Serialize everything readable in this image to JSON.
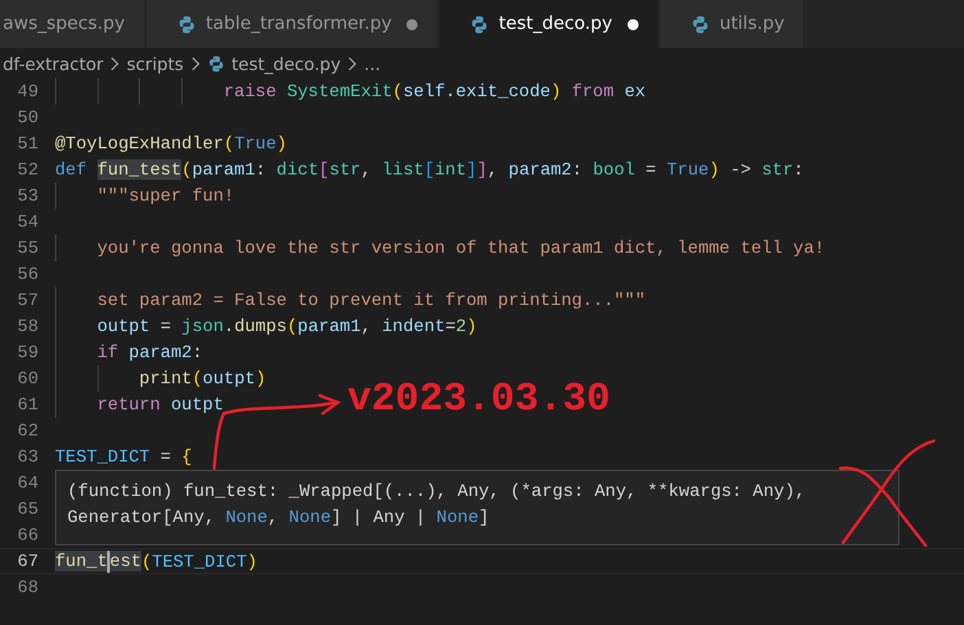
{
  "tabs": [
    {
      "label": "aws_specs.py",
      "selected": false,
      "modified": false,
      "icon": false
    },
    {
      "label": "table_transformer.py",
      "selected": false,
      "modified": true,
      "icon": true
    },
    {
      "label": "test_deco.py",
      "selected": true,
      "modified": true,
      "icon": true
    },
    {
      "label": "utils.py",
      "selected": false,
      "modified": false,
      "icon": true
    }
  ],
  "breadcrumb": [
    {
      "label": "df-extractor",
      "icon": false
    },
    {
      "label": "scripts",
      "icon": false
    },
    {
      "label": "test_deco.py",
      "icon": true
    },
    {
      "label": "...",
      "icon": false
    }
  ],
  "lines": [
    {
      "number": "49",
      "tokens": [
        {
          "t": "                raise ",
          "kind": "kw"
        },
        {
          "t": "SystemExit",
          "kind": "cls"
        },
        {
          "t": "(",
          "kind": "b1"
        },
        {
          "t": "self",
          "kind": "var"
        },
        {
          "t": ".exit_code",
          "kind": "var"
        },
        {
          "t": ") ",
          "kind": "b1"
        },
        {
          "t": "from ",
          "kind": "kw"
        },
        {
          "t": "ex",
          "kind": "var"
        }
      ]
    },
    {
      "number": "50"
    },
    {
      "number": "51",
      "tokens": [
        {
          "t": "@ToyLogExHandler",
          "kind": "fn"
        },
        {
          "t": "(",
          "kind": "b1"
        },
        {
          "t": "True",
          "kind": "def"
        },
        {
          "t": ")",
          "kind": "b1"
        }
      ]
    },
    {
      "number": "52",
      "tokens": [
        {
          "t": "def ",
          "kind": "def"
        },
        {
          "t": "fun_test",
          "kind": "fn",
          "highlight": true
        },
        {
          "t": "(",
          "kind": "b1"
        },
        {
          "t": "param1",
          "kind": "var"
        },
        {
          "t": ": ",
          "kind": "plain"
        },
        {
          "t": "dict",
          "kind": "cls"
        },
        {
          "t": "[",
          "kind": "b2"
        },
        {
          "t": "str",
          "kind": "cls"
        },
        {
          "t": ", ",
          "kind": "plain"
        },
        {
          "t": "list",
          "kind": "cls"
        },
        {
          "t": "[",
          "kind": "b3"
        },
        {
          "t": "int",
          "kind": "cls"
        },
        {
          "t": "]",
          "kind": "b3"
        },
        {
          "t": "]",
          "kind": "b2"
        },
        {
          "t": ", ",
          "kind": "plain"
        },
        {
          "t": "param2",
          "kind": "var"
        },
        {
          "t": ": ",
          "kind": "plain"
        },
        {
          "t": "bool",
          "kind": "cls"
        },
        {
          "t": " = ",
          "kind": "plain"
        },
        {
          "t": "True",
          "kind": "def"
        },
        {
          "t": ")",
          "kind": "b1"
        },
        {
          "t": " -> ",
          "kind": "plain"
        },
        {
          "t": "str",
          "kind": "cls"
        },
        {
          "t": ":",
          "kind": "plain"
        }
      ]
    },
    {
      "number": "53",
      "tokens": [
        {
          "t": "    \"\"\"super fun!",
          "kind": "str"
        }
      ]
    },
    {
      "number": "54"
    },
    {
      "number": "55",
      "tokens": [
        {
          "t": "    you're gonna love the str version of that param1 dict, lemme tell ya!",
          "kind": "str"
        }
      ]
    },
    {
      "number": "56"
    },
    {
      "number": "57",
      "tokens": [
        {
          "t": "    set param2 = False to prevent it from printing...\"\"\"",
          "kind": "str"
        }
      ]
    },
    {
      "number": "58",
      "tokens": [
        {
          "t": "    outpt",
          "kind": "var"
        },
        {
          "t": " = ",
          "kind": "plain"
        },
        {
          "t": "json",
          "kind": "cls"
        },
        {
          "t": ".",
          "kind": "plain"
        },
        {
          "t": "dumps",
          "kind": "fn"
        },
        {
          "t": "(",
          "kind": "b1"
        },
        {
          "t": "param1",
          "kind": "var"
        },
        {
          "t": ", ",
          "kind": "plain"
        },
        {
          "t": "indent",
          "kind": "var"
        },
        {
          "t": "=",
          "kind": "plain"
        },
        {
          "t": "2",
          "kind": "num"
        },
        {
          "t": ")",
          "kind": "b1"
        }
      ]
    },
    {
      "number": "59",
      "tokens": [
        {
          "t": "    if ",
          "kind": "kw"
        },
        {
          "t": "param2",
          "kind": "var"
        },
        {
          "t": ":",
          "kind": "plain"
        }
      ]
    },
    {
      "number": "60",
      "tokens": [
        {
          "t": "        print",
          "kind": "fn"
        },
        {
          "t": "(",
          "kind": "b1"
        },
        {
          "t": "outpt",
          "kind": "var"
        },
        {
          "t": ")",
          "kind": "b1"
        }
      ]
    },
    {
      "number": "61",
      "tokens": [
        {
          "t": "    return ",
          "kind": "kw"
        },
        {
          "t": "outpt",
          "kind": "var"
        }
      ]
    },
    {
      "number": "62"
    },
    {
      "number": "63",
      "tokens": [
        {
          "t": "TEST_DICT",
          "kind": "const"
        },
        {
          "t": " = ",
          "kind": "plain"
        },
        {
          "t": "{",
          "kind": "b1"
        }
      ]
    },
    {
      "number": "64"
    },
    {
      "number": "65"
    },
    {
      "number": "66"
    },
    {
      "number": "67",
      "current": true,
      "tokens": [
        {
          "t": "fun_t",
          "kind": "fn",
          "highlight": true,
          "cursor_after": true
        },
        {
          "t": "est",
          "kind": "fn",
          "highlight": true
        },
        {
          "t": "(",
          "kind": "b1"
        },
        {
          "t": "TEST_DICT",
          "kind": "const"
        },
        {
          "t": ")",
          "kind": "b1"
        }
      ]
    },
    {
      "number": "68"
    }
  ],
  "hover": {
    "lines": [
      [
        {
          "t": "(function) fun_test: _Wrapped[(...), Any, (*args: Any, **kwargs: Any),",
          "kind": "plain"
        }
      ],
      [
        {
          "t": "Generator[Any, ",
          "kind": "plain"
        },
        {
          "t": "None",
          "kind": "def"
        },
        {
          "t": ", ",
          "kind": "plain"
        },
        {
          "t": "None",
          "kind": "def"
        },
        {
          "t": "] | Any | ",
          "kind": "plain"
        },
        {
          "t": "None",
          "kind": "def"
        },
        {
          "t": "]",
          "kind": "plain"
        }
      ]
    ]
  },
  "annotation": {
    "text": "v2023.03.30"
  }
}
